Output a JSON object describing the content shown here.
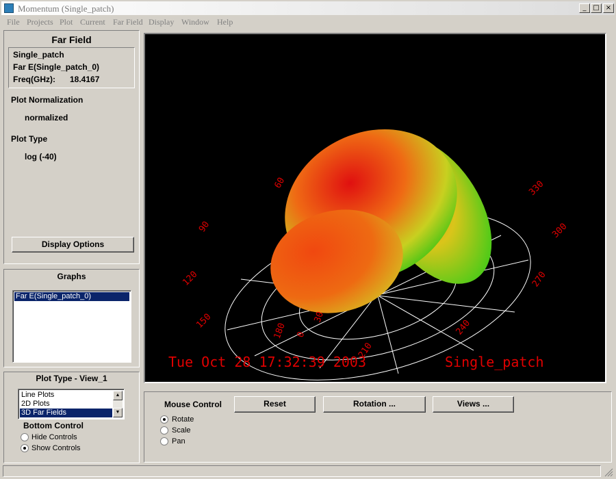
{
  "window": {
    "title": "Momentum (Single_patch)"
  },
  "menu": [
    "File",
    "Projects",
    "Plot",
    "Current",
    "Far Field",
    "Display",
    "Window",
    "Help"
  ],
  "farfield": {
    "heading": "Far Field",
    "project": "Single_patch",
    "field": "Far E(Single_patch_0)",
    "freq_label": "Freq(GHz):",
    "freq_value": "18.4167",
    "norm_label": "Plot Normalization",
    "norm_value": "normalized",
    "type_label": "Plot Type",
    "type_value": "log (-40)",
    "display_options": "Display Options"
  },
  "graphs": {
    "heading": "Graphs",
    "items": [
      "Far E(Single_patch_0)"
    ]
  },
  "plottype": {
    "heading": "Plot Type - View_1",
    "items": [
      "Line Plots",
      "2D Plots",
      "3D Far Fields"
    ],
    "bottom_label": "Bottom Control",
    "hide": "Hide Controls",
    "show": "Show Controls"
  },
  "plot": {
    "timestamp": "Tue Oct 28 17:32:39 2003",
    "name": "Single_patch",
    "angles": [
      "0",
      "30",
      "60",
      "90",
      "120",
      "150",
      "180",
      "210",
      "240",
      "270",
      "300",
      "330"
    ]
  },
  "mouse": {
    "label": "Mouse Control",
    "reset": "Reset",
    "rotation": "Rotation ...",
    "views": "Views ...",
    "rotate": "Rotate",
    "scale": "Scale",
    "pan": "Pan"
  },
  "colors": {
    "selection": "#0a246a",
    "plot_text": "#e00000"
  }
}
